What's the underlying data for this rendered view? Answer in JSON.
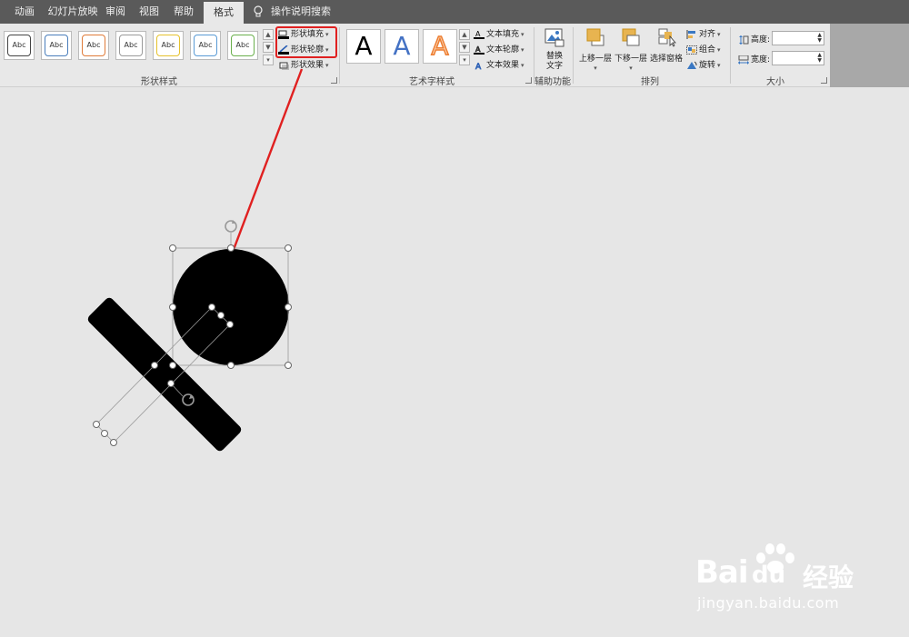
{
  "tabs": [
    {
      "label": "动画",
      "active": false
    },
    {
      "label": "幻灯片放映",
      "active": false
    },
    {
      "label": "审阅",
      "active": false
    },
    {
      "label": "视图",
      "active": false
    },
    {
      "label": "帮助",
      "active": false
    },
    {
      "label": "格式",
      "active": true
    }
  ],
  "tell_me": "操作说明搜索",
  "shape_styles": {
    "label": "形状样式",
    "preset_text": "Abc",
    "preset_colors": [
      "#444444",
      "#4a7ebb",
      "#e07b39",
      "#9a9a9a",
      "#e5c22e",
      "#5a9bd5",
      "#6ab04c"
    ],
    "fill": "形状填充",
    "outline": "形状轮廓",
    "effects": "形状效果"
  },
  "wordart": {
    "label": "艺术字样式",
    "letter": "A",
    "fill": "文本填充",
    "outline": "文本轮廓",
    "effects": "文本效果"
  },
  "accessibility": {
    "label": "辅助功能",
    "alt_text_line1": "替换",
    "alt_text_line2": "文字"
  },
  "arrange": {
    "label": "排列",
    "bring_forward": "上移一层",
    "send_backward": "下移一层",
    "selection_pane": "选择窗格",
    "align": "对齐",
    "group": "组合",
    "rotate": "旋转"
  },
  "size": {
    "label": "大小",
    "height_label": "高度:",
    "width_label": "宽度:",
    "height_value": "",
    "width_value": ""
  },
  "watermark": {
    "brand": "Bai",
    "brand2": "du",
    "cn": "经验",
    "url": "jingyan.baidu.com"
  },
  "colors": {
    "annotation": "#e02020",
    "tabbar": "#5a5a5a",
    "shape": "#000000"
  }
}
